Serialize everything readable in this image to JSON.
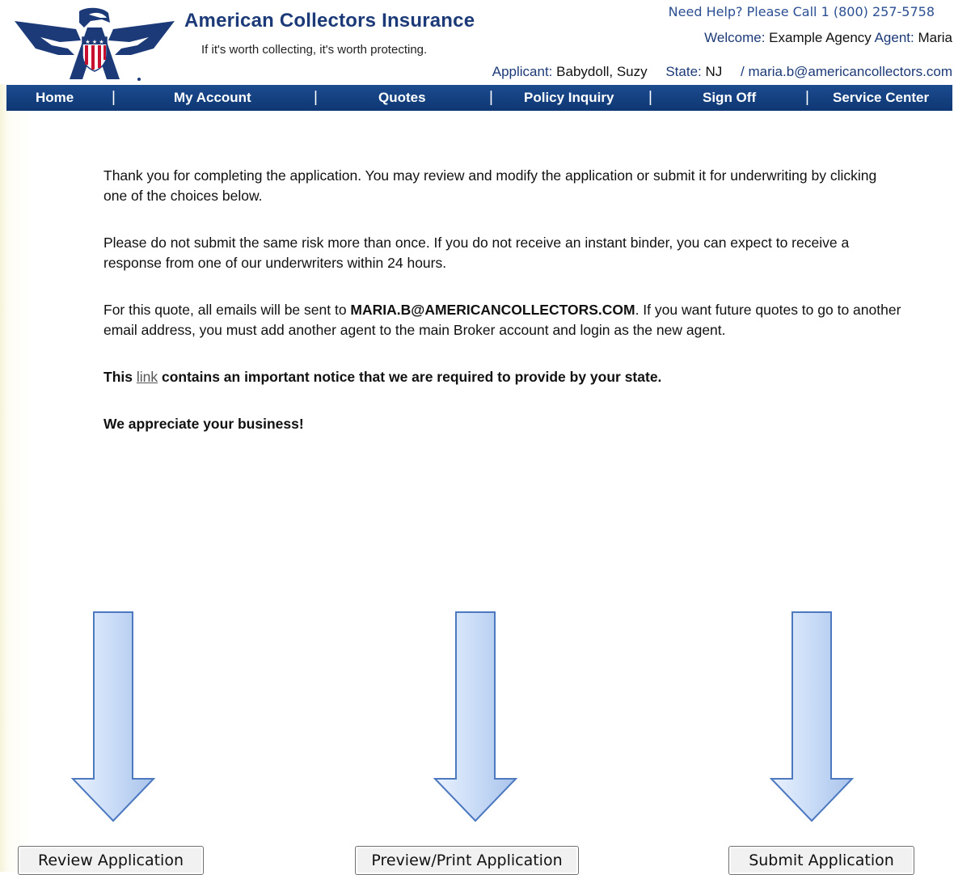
{
  "brand": {
    "name": "American Collectors Insurance",
    "tagline": "If it's worth collecting, it's worth protecting."
  },
  "header": {
    "help": "Need Help? Please Call 1 (800) 257-5758",
    "welcome_label": "Welcome:",
    "agency": "Example Agency",
    "agent_label": "Agent:",
    "agent": "Maria",
    "applicant_label": "Applicant:",
    "applicant": "Babydoll, Suzy",
    "state_label": "State:",
    "state": "NJ",
    "email_sep": "/",
    "email": "maria.b@americancollectors.com"
  },
  "nav": {
    "items": [
      "Home",
      "My Account",
      "Quotes",
      "Policy Inquiry",
      "Sign Off",
      "Service Center"
    ],
    "separator": "|"
  },
  "content": {
    "p1": "Thank you for completing the application. You may review and modify the application or submit it for underwriting by clicking one of the choices below.",
    "p2": "Please do not submit the same risk more than once. If you do not receive an instant binder, you can expect to receive a response from one of our underwriters within 24 hours.",
    "p3_before": "For this quote, all emails will be sent to ",
    "p3_email": "MARIA.B@AMERICANCOLLECTORS.COM",
    "p3_after": ". If you want future quotes to go to another email address, you must add another agent to the main Broker account and login as the new agent.",
    "p4_before": "This ",
    "p4_link": "link",
    "p4_after": " contains an important notice that we are required to provide by your state.",
    "p5": "We appreciate your business!"
  },
  "buttons": {
    "review": "Review Application",
    "preview": "Preview/Print Application",
    "submit": "Submit Application"
  },
  "colors": {
    "brand_blue": "#1c3a78",
    "nav_blue": "#0e3773",
    "arrow_fill": "#c9dcf7",
    "logo_red": "#c8102e"
  }
}
